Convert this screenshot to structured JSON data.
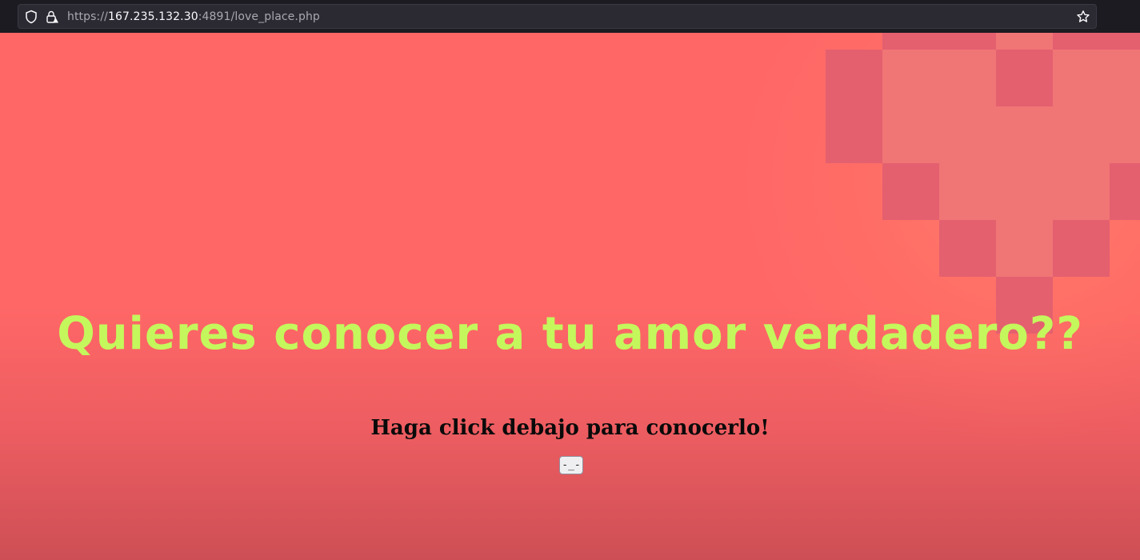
{
  "browser": {
    "url_scheme": "https://",
    "url_host": "167.235.132.30",
    "url_rest": ":4891/love_place.php",
    "icons": [
      "shield-icon",
      "lock-warning-icon",
      "bookmark-star-icon"
    ]
  },
  "main": {
    "headline": "Quieres conocer a tu amor verdadero??",
    "subtitle": "Haga click debajo para conocerlo!",
    "button_label": "-_-"
  },
  "colors": {
    "background": "#ff6767",
    "headline": "#c4f75c",
    "heart_dark": "#e4606f",
    "heart_light": "#f07575"
  }
}
